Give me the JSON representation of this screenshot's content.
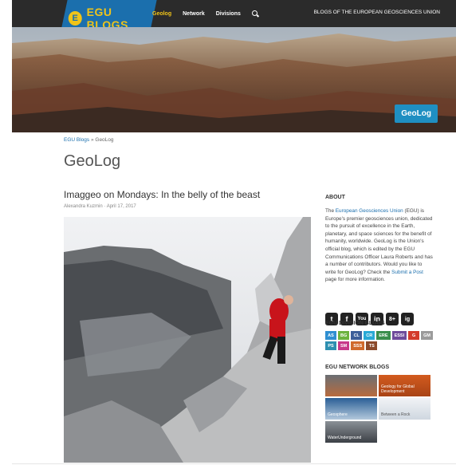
{
  "nav": {
    "logo_badge": "E",
    "logo_text": "EGU BLOGS",
    "items": [
      "Geolog",
      "Network",
      "Divisions"
    ],
    "tagline": "BLOGS OF THE EUROPEAN GEOSCIENCES UNION"
  },
  "banner": {
    "badge": "GeoLog"
  },
  "breadcrumb": {
    "home": "EGU Blogs",
    "sep": " » ",
    "current": "GeoLog"
  },
  "page_title": "GeoLog",
  "post": {
    "title": "Imaggeo on Mondays: In the belly of the beast",
    "author": "Alexandra Kuzmin",
    "date": "April 17, 2017"
  },
  "sidebar": {
    "about_heading": "ABOUT",
    "about": {
      "p1": "The ",
      "link1": "European Geosciences Union",
      "p2": " (EGU) is Europe's premier geosciences union, dedicated to the pursuit of excellence in the Earth, planetary, and space sciences for the benefit of humanity, worldwide. GeoLog is the Union's official blog, which is edited by the EGU Communications Officer Laura Roberts and has a number of contributors. Would you like to write for GeoLog? Check the ",
      "link2": "Submit a Post",
      "p3": " page for more information."
    },
    "social": [
      "t",
      "f",
      "You",
      "in",
      "8+",
      "ig"
    ],
    "division_heading": "EGU DIVISION BLOGS",
    "divisions": [
      {
        "label": "AS",
        "color": "#2f8fd1"
      },
      {
        "label": "BG",
        "color": "#6cb33f"
      },
      {
        "label": "CL",
        "color": "#3d5f9a"
      },
      {
        "label": "CR",
        "color": "#29a9d6"
      },
      {
        "label": "ERE",
        "color": "#3a8e4c"
      },
      {
        "label": "ESSI",
        "color": "#6f4c9b"
      },
      {
        "label": "G",
        "color": "#d33b2c"
      },
      {
        "label": "GM",
        "color": "#9b9b9b"
      },
      {
        "label": "PS",
        "color": "#2d8fb0"
      },
      {
        "label": "SM",
        "color": "#c7398a"
      },
      {
        "label": "SSS",
        "color": "#d06a2c"
      },
      {
        "label": "TS",
        "color": "#8b4a2b"
      }
    ],
    "network_heading": "EGU NETWORK BLOGS",
    "network": [
      "",
      "Geology for Global Development",
      "Geosphere",
      "Between a Rock",
      "WaterUnderground"
    ]
  }
}
